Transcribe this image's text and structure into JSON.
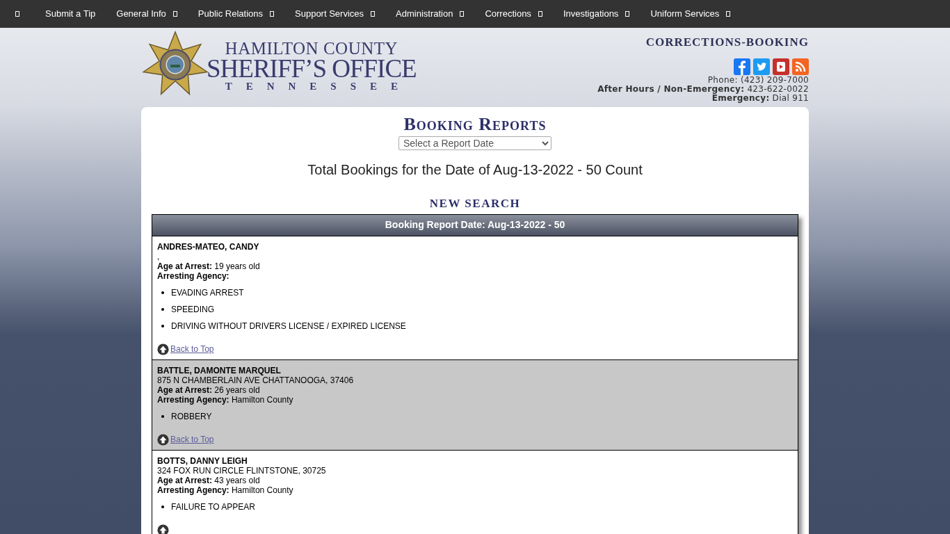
{
  "nav": {
    "items": [
      {
        "label": "Submit a Tip",
        "dropdown": false
      },
      {
        "label": "General Info",
        "dropdown": true
      },
      {
        "label": "Public Relations",
        "dropdown": true
      },
      {
        "label": "Support Services",
        "dropdown": true
      },
      {
        "label": "Administration",
        "dropdown": true
      },
      {
        "label": "Corrections",
        "dropdown": true
      },
      {
        "label": "Investigations",
        "dropdown": true
      },
      {
        "label": "Uniform Services",
        "dropdown": true
      }
    ]
  },
  "header": {
    "logo": {
      "line_1": "HAMILTON COUNTY",
      "line_2": "SHERIFF’S OFFICE",
      "line_3": "TENNESSEE"
    },
    "section_title": "CORRECTIONS-BOOKING",
    "contacts": [
      "Phone: (423) 209-7000",
      "**After Hours / Non-Emergency:** 423-622-0022",
      "**Emergency:** Dial 911"
    ]
  },
  "main": {
    "title": "Booking Reports",
    "date_select": {
      "placeholder": "Select a Report Date"
    },
    "total": "Total Bookings for the Date of Aug-13-2022 - 50 Count",
    "new_search": "NEW SEARCH",
    "table": {
      "header": "Booking Report Date: Aug-13-2022 - 50",
      "records": [
        {
          "name": "ANDRES-MATEO, CANDY",
          "address": ",",
          "age": "**Age at Arrest:** 19 years old",
          "agency": "**Arresting Agency:**",
          "charges": [
            "EVADING ARREST",
            "SPEEDING",
            "DRIVING WITHOUT DRIVERS LICENSE / EXPIRED LICENSE"
          ],
          "back_to_top": "Back to Top"
        },
        {
          "name": "BATTLE, DAMONTE MARQUEL",
          "address": "875 N CHAMBERLAIN AVE CHATTANOOGA, 37406",
          "age": "**Age at Arrest:** 26 years old",
          "agency": "**Arresting Agency:** Hamilton County",
          "charges": [
            "ROBBERY"
          ],
          "back_to_top": "Back to Top"
        },
        {
          "name": "BOTTS, DANNY LEIGH",
          "address": "324 FOX RUN CIRCLE FLINTSTONE, 30725",
          "age": "**Age at Arrest:** 43 years old",
          "agency": "**Arresting Agency:** Hamilton County",
          "charges": [
            "FAILURE TO APPEAR"
          ]
        }
      ]
    }
  }
}
